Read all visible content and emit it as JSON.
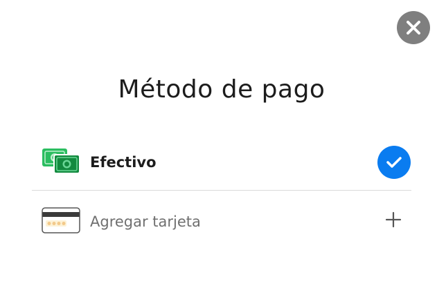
{
  "modal": {
    "title": "Método de pago",
    "close_icon": "close-icon"
  },
  "payment_options": [
    {
      "label": "Efectivo",
      "icon": "cash-icon",
      "selected": true,
      "status_icon": "check-icon"
    },
    {
      "label": "Agregar tarjeta",
      "icon": "credit-card-icon",
      "selected": false,
      "status_icon": "plus-icon"
    }
  ],
  "colors": {
    "accent": "#0A7CF0",
    "close_button": "#7F7F7F",
    "cash_green": "#1EA84F",
    "title_text": "#1C1C1C",
    "secondary_text": "#6F6F6F",
    "divider": "#D9D9D9"
  }
}
